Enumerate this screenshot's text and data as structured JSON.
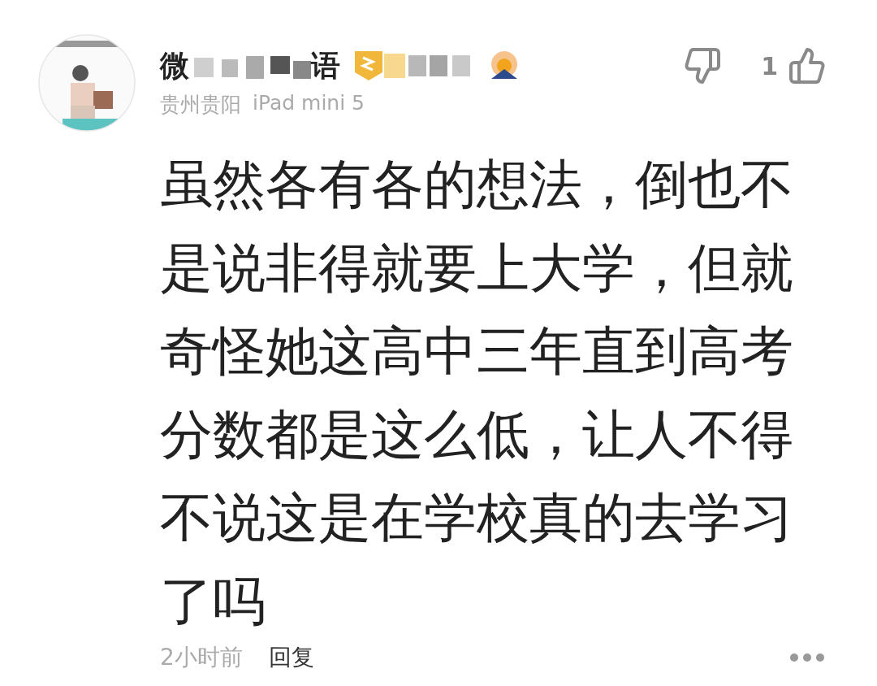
{
  "comment": {
    "user": {
      "name_start": "微",
      "name_end": "语",
      "location": "贵州贵阳",
      "device": "iPad mini 5"
    },
    "like_count": "1",
    "text": "虽然各有各的想法，倒也不是说非得就要上大学，但就奇怪她这高中三年直到高考分数都是这么低，让人不得不说这是在学校真的去学习了吗",
    "time": "2小时前",
    "reply": "回复"
  }
}
